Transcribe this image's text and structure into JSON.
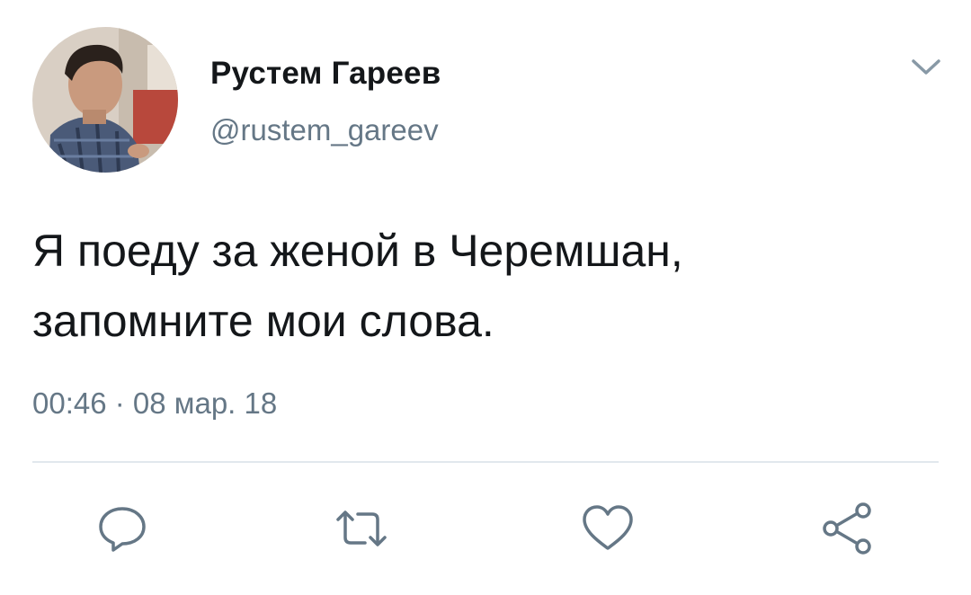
{
  "tweet": {
    "author_name": "Рустем Гареев",
    "author_handle": "@rustem_gareev",
    "text_line1": "Я поеду за женой в Черемшан,",
    "text_line2": "запомните мои слова.",
    "timestamp": "00:46 · 08 мар. 18"
  },
  "icons": {
    "menu": "chevron-down-icon",
    "reply": "reply-icon",
    "retweet": "retweet-icon",
    "like": "heart-icon",
    "share": "share-icon"
  },
  "colors": {
    "text_primary": "#14171a",
    "text_secondary": "#657786",
    "icon": "#657786",
    "divider": "#e1e8ed",
    "background": "#ffffff"
  }
}
